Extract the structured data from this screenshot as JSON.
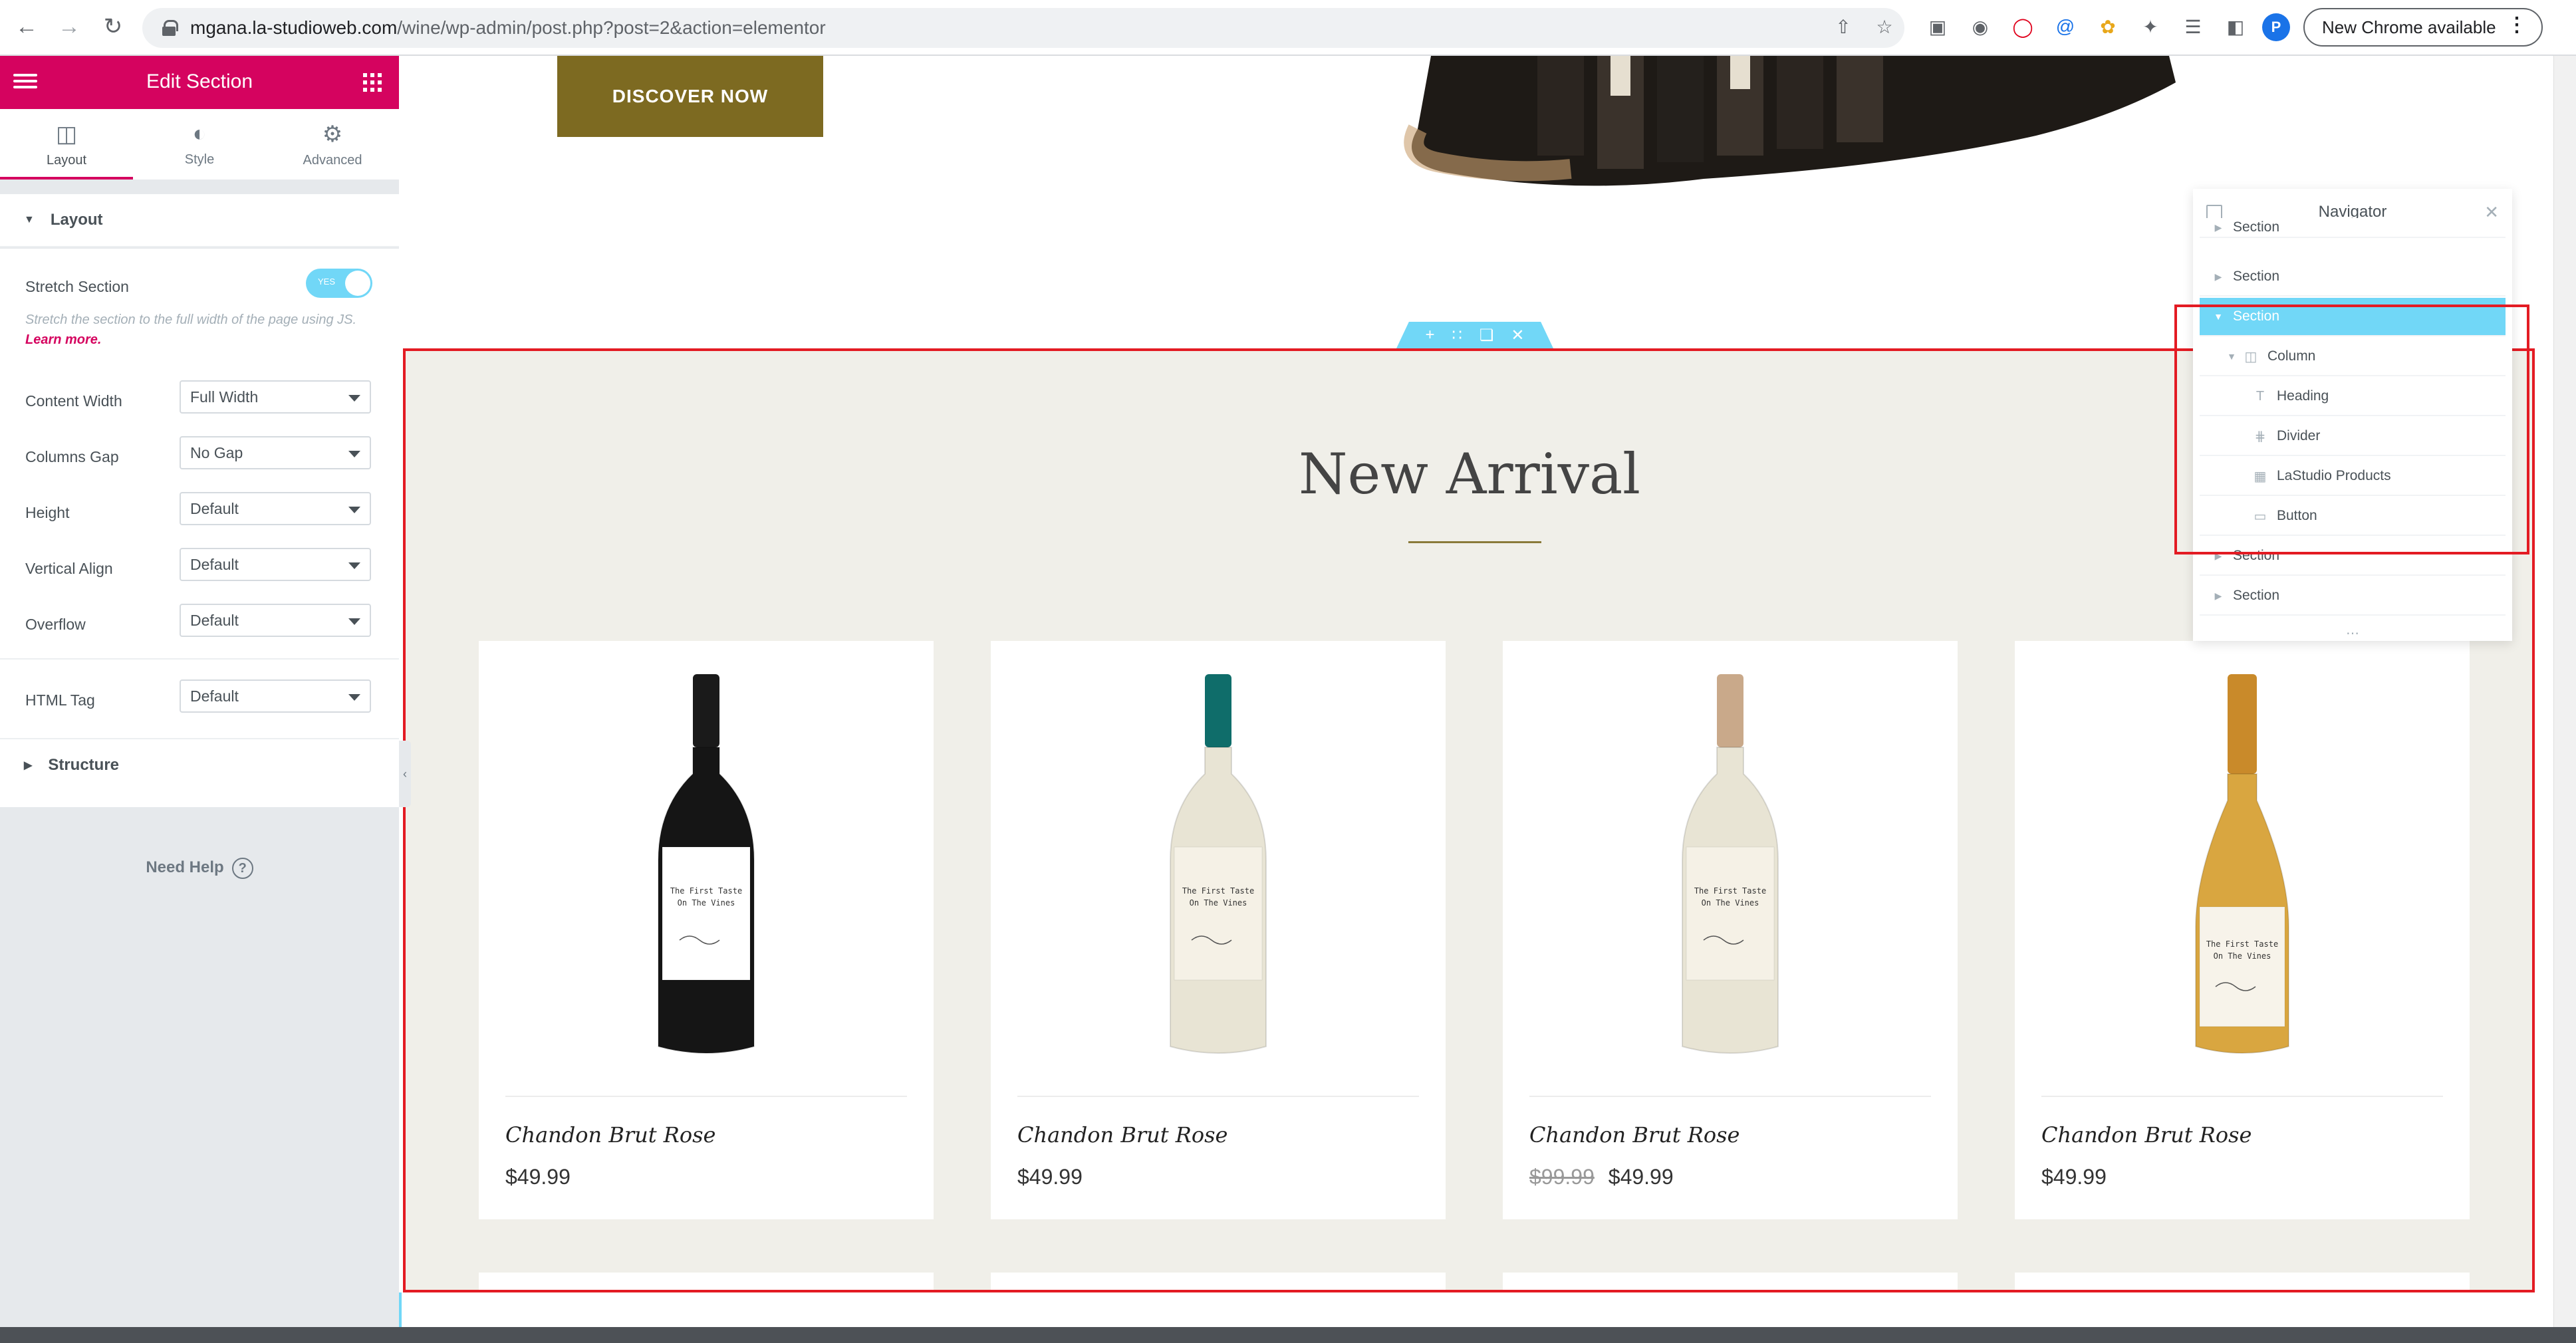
{
  "browser": {
    "url_host": "mgana.la-studioweb.com",
    "url_path": "/wine/wp-admin/post.php?post=2&action=elementor",
    "new_chrome_label": "New Chrome available",
    "profile_initial": "P"
  },
  "panel": {
    "title": "Edit Section",
    "tabs": [
      {
        "label": "Layout",
        "icon": "layout-icon"
      },
      {
        "label": "Style",
        "icon": "style-icon"
      },
      {
        "label": "Advanced",
        "icon": "gear-icon"
      }
    ],
    "layout_section_title": "Layout",
    "stretch_label": "Stretch Section",
    "stretch_toggle": "YES",
    "stretch_desc": "Stretch the section to the full width of the page using JS.",
    "stretch_link": "Learn more.",
    "controls": [
      {
        "label": "Content Width",
        "value": "Full Width"
      },
      {
        "label": "Columns Gap",
        "value": "No Gap"
      },
      {
        "label": "Height",
        "value": "Default"
      },
      {
        "label": "Vertical Align",
        "value": "Default"
      },
      {
        "label": "Overflow",
        "value": "Default"
      }
    ],
    "html_tag": {
      "label": "HTML Tag",
      "value": "Default"
    },
    "structure_title": "Structure",
    "help_label": "Need Help"
  },
  "canvas": {
    "discover_label": "DISCOVER NOW",
    "heading": "New Arrival",
    "products": [
      {
        "name": "Chandon Brut Rose",
        "price": "$49.99",
        "old_price": "",
        "capsule": "#1a1a1a",
        "glass": "#151515",
        "label_color": "#ffffff"
      },
      {
        "name": "Chandon Brut Rose",
        "price": "$49.99",
        "old_price": "",
        "capsule": "#0f6d6a",
        "glass": "#e8e4d4",
        "label_color": "#f5f1e6"
      },
      {
        "name": "Chandon Brut Rose",
        "price": "$49.99",
        "old_price": "$99.99",
        "capsule": "#c9a98a",
        "glass": "#e8e4d4",
        "label_color": "#f5f1e6"
      },
      {
        "name": "Chandon Brut Rose",
        "price": "$49.99",
        "old_price": "",
        "capsule": "#c98a2a",
        "glass": "#d9a640",
        "label_color": "#f7f3ea"
      }
    ],
    "bottle_label_text": "The First Taste On The Vines"
  },
  "navigator": {
    "title": "Navigator",
    "items": [
      {
        "label": "Section",
        "level": 0,
        "active": false
      },
      {
        "label": "Section",
        "level": 0,
        "active": false
      },
      {
        "label": "Section",
        "level": 0,
        "active": true
      },
      {
        "label": "Column",
        "level": 1,
        "active": false
      },
      {
        "label": "Heading",
        "level": 2,
        "active": false
      },
      {
        "label": "Divider",
        "level": 2,
        "active": false
      },
      {
        "label": "LaStudio Products",
        "level": 2,
        "active": false
      },
      {
        "label": "Button",
        "level": 2,
        "active": false
      },
      {
        "label": "Section",
        "level": 0,
        "active": false
      },
      {
        "label": "Section",
        "level": 0,
        "active": false
      }
    ]
  },
  "colors": {
    "elementor_pink": "#d5035f",
    "elementor_blue": "#71d7f7",
    "highlight_red": "#e31b23",
    "gold": "#7d6a21"
  }
}
